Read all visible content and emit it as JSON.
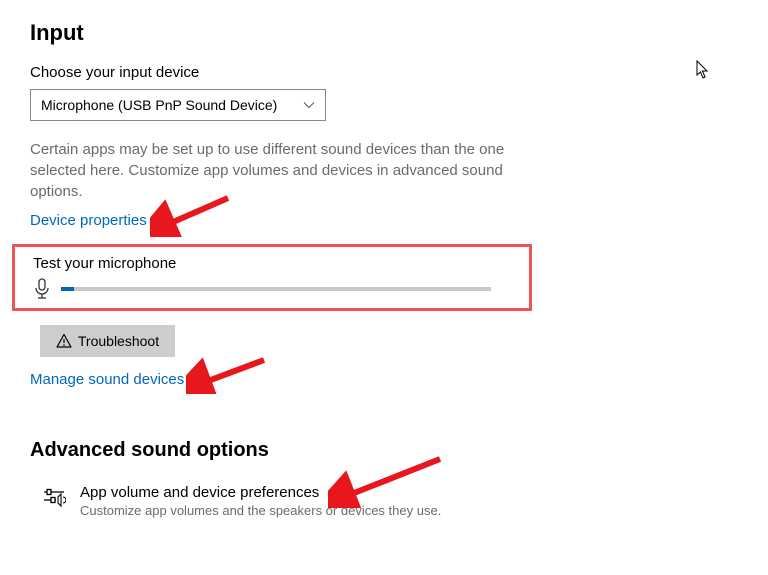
{
  "input": {
    "heading": "Input",
    "choose_label": "Choose your input device",
    "device_selected": "Microphone (USB PnP Sound Device)",
    "description": "Certain apps may be set up to use different sound devices than the one selected here. Customize app volumes and devices in advanced sound options.",
    "device_properties_link": "Device properties",
    "test_label": "Test your microphone",
    "mic_level_percent": "3",
    "troubleshoot_label": "Troubleshoot",
    "manage_link": "Manage sound devices"
  },
  "advanced": {
    "heading": "Advanced sound options",
    "pref_title": "App volume and device preferences",
    "pref_subtitle": "Customize app volumes and the speakers or devices they use."
  },
  "annotations": {
    "highlight_color": "#eb5757",
    "arrow_color": "#e8171e"
  }
}
